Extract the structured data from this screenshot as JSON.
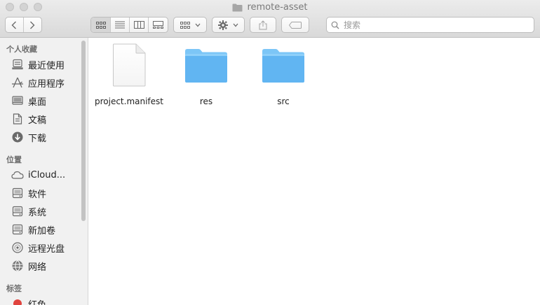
{
  "window": {
    "title": "remote-asset"
  },
  "toolbar": {
    "search_placeholder": "搜索"
  },
  "sidebar": {
    "sections": [
      {
        "title": "个人收藏",
        "items": [
          {
            "label": "最近使用",
            "icon": "recents-icon"
          },
          {
            "label": "应用程序",
            "icon": "applications-icon"
          },
          {
            "label": "桌面",
            "icon": "desktop-icon"
          },
          {
            "label": "文稿",
            "icon": "documents-icon"
          },
          {
            "label": "下载",
            "icon": "downloads-icon"
          }
        ]
      },
      {
        "title": "位置",
        "items": [
          {
            "label": "iCloud...",
            "icon": "icloud-icon"
          },
          {
            "label": "软件",
            "icon": "disk-icon"
          },
          {
            "label": "系统",
            "icon": "disk-icon"
          },
          {
            "label": "新加卷",
            "icon": "disk-icon"
          },
          {
            "label": "远程光盘",
            "icon": "remote-disc-icon"
          },
          {
            "label": "网络",
            "icon": "network-icon"
          }
        ]
      },
      {
        "title": "标签",
        "items": [
          {
            "label": "红色",
            "icon": "red-tag-icon",
            "color": "#e0443e"
          }
        ]
      }
    ]
  },
  "files": [
    {
      "name": "project.manifest",
      "type": "document"
    },
    {
      "name": "res",
      "type": "folder"
    },
    {
      "name": "src",
      "type": "folder"
    }
  ],
  "colors": {
    "folder_top": "#7cc6f7",
    "folder_body": "#61b5f2",
    "tag_red": "#e0443e"
  }
}
